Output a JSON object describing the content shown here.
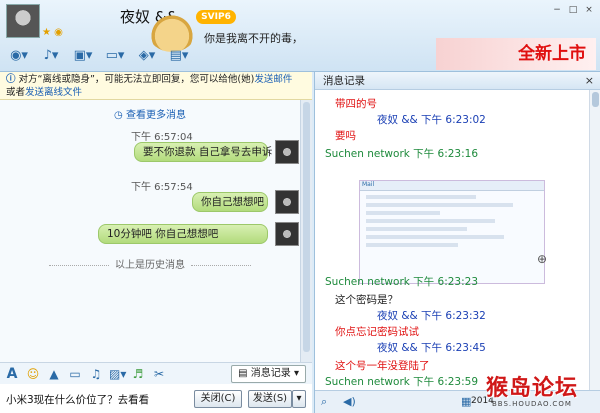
{
  "header": {
    "contact_name": "夜奴 &&",
    "svip_label": "SVIP6",
    "status_message": "你是我离不开的毒，",
    "sys_buttons": [
      "−",
      "□",
      "×"
    ],
    "promo_text": "全新上市"
  },
  "toolbar": {
    "icons": [
      "camera-icon",
      "mic-icon",
      "folder-icon",
      "screen-share-icon",
      "app-icon",
      "more-icon"
    ]
  },
  "notice": {
    "icon": "ⓘ",
    "text1": "对方“离线或隐身”，可能无法立即回复，您可以给他(她)",
    "link1": "发送邮件",
    "text2": "或者",
    "link2": "发送离线文件"
  },
  "chat": {
    "more_messages": "查看更多消息",
    "messages": [
      {
        "time": "下午 6:57:04",
        "text": "要不你退款 自己拿号去申诉"
      },
      {
        "time": "下午 6:57:54",
        "text": "你自己想想吧"
      },
      {
        "time": "",
        "text": "10分钟吧                           你自己想想吧"
      }
    ],
    "history_divider": "以上是历史消息"
  },
  "input_bar": {
    "message_record_button": "消息记录"
  },
  "input_area": {
    "typed_text": "小米3现在什么价位了？去看看",
    "close_button": "关闭(C)",
    "send_button": "发送(S)"
  },
  "record_panel": {
    "title": "消息记录",
    "close": "×",
    "entries": [
      {
        "text": "带四的号",
        "color": "red"
      },
      {
        "text": "夜奴  &&   下午 6:23:02",
        "color": "blue"
      },
      {
        "text": "要吗",
        "color": "red"
      },
      {
        "text": "Suchen network 下午 6:23:16",
        "color": "green"
      },
      {
        "text": "Suchen network 下午 6:23:23",
        "color": "green"
      },
      {
        "text": "这个密码是？",
        "color": "dark"
      },
      {
        "text": "夜奴  &&   下午 6:23:32",
        "color": "blue"
      },
      {
        "text": "你点忘记密码试试",
        "color": "red"
      },
      {
        "text": "夜奴  &&   下午 6:23:45",
        "color": "blue"
      },
      {
        "text": "这个号一年没登陆了",
        "color": "red"
      },
      {
        "text": "Suchen network 下午 6:23:59",
        "color": "green"
      }
    ],
    "screenshot_brand": "Mail",
    "date": "2014"
  },
  "watermark": {
    "big": "猴岛论坛",
    "small": "BBS.HOUDAO.COM"
  },
  "colors": {
    "bubble": "#b2db7c",
    "link": "#1a5fb4",
    "red_text": "#e01010",
    "green_text": "#1e8a3c",
    "blue_text": "#1a3fb4"
  }
}
